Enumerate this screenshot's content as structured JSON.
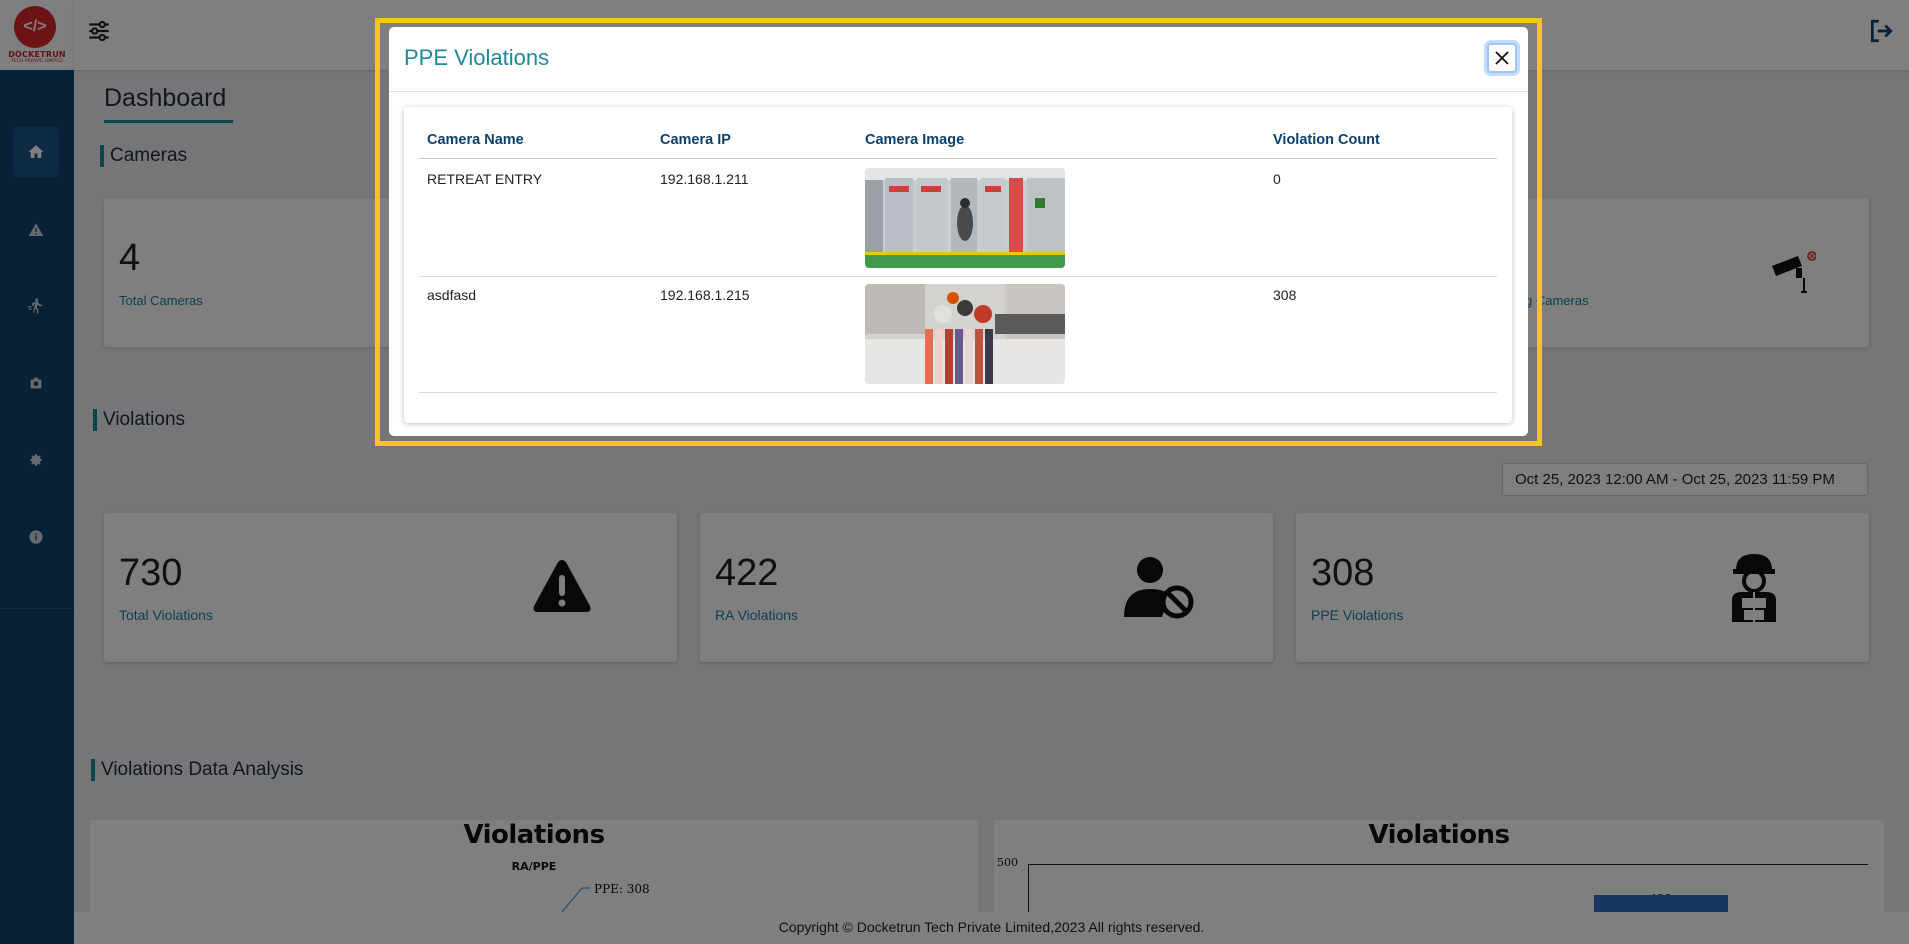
{
  "brand": {
    "name": "DOCKETRUN",
    "tagline": "TECH PRIVATE LIMITED",
    "logo_mark": "</>"
  },
  "sidebar": {
    "items": [
      {
        "icon": "home-icon",
        "active": true
      },
      {
        "icon": "warning-icon",
        "active": false
      },
      {
        "icon": "running-person-icon",
        "active": false
      },
      {
        "icon": "camera-icon",
        "active": false
      },
      {
        "icon": "gear-icon",
        "active": false
      },
      {
        "icon": "info-icon",
        "active": false
      }
    ]
  },
  "header": {
    "filter_icon": "sliders-icon",
    "logout_icon": "logout-icon"
  },
  "dashboard": {
    "title": "Dashboard",
    "cameras_section": "Cameras",
    "cameras": {
      "total_value": "4",
      "total_label": "Total Cameras",
      "right_label_partial": "g Cameras"
    },
    "violations_section": "Violations",
    "date_range": "Oct 25, 2023 12:00 AM - Oct 25, 2023 11:59 PM",
    "violation_cards": [
      {
        "value": "730",
        "label": "Total Violations",
        "icon": "warning-triangle-icon"
      },
      {
        "value": "422",
        "label": "RA Violations",
        "icon": "person-blocked-icon"
      },
      {
        "value": "308",
        "label": "PPE Violations",
        "icon": "helmet-worker-icon"
      }
    ],
    "analysis_section": "Violations Data Analysis"
  },
  "charts": {
    "left_title": "Violations",
    "left_subtitle": "RA/PPE",
    "right_title": "Violations"
  },
  "chart_data": [
    {
      "type": "pie",
      "title": "Violations",
      "subtitle": "RA/PPE",
      "labels": [
        "PPE"
      ],
      "values": [
        308
      ],
      "data_labels": [
        "PPE: 308"
      ]
    },
    {
      "type": "bar",
      "title": "Violations",
      "categories": [
        ""
      ],
      "values": [
        422
      ],
      "data_labels": [
        "422"
      ],
      "yticks": [
        "500"
      ]
    }
  ],
  "footer": {
    "text": "Copyright © Docketrun Tech Private Limited,2023 All rights reserved."
  },
  "modal": {
    "title": "PPE Violations",
    "close_icon": "close-icon",
    "columns": [
      "Camera Name",
      "Camera IP",
      "Camera Image",
      "Violation Count"
    ],
    "rows": [
      {
        "name": "RETREAT ENTRY",
        "ip": "192.168.1.211",
        "count": "0"
      },
      {
        "name": "asdfasd",
        "ip": "192.168.1.215",
        "count": "308"
      }
    ]
  },
  "colors": {
    "sidebar": "#0e426c",
    "accent": "#1a8a9a",
    "highlight": "#f5c518",
    "brand_red": "#d6262b"
  }
}
